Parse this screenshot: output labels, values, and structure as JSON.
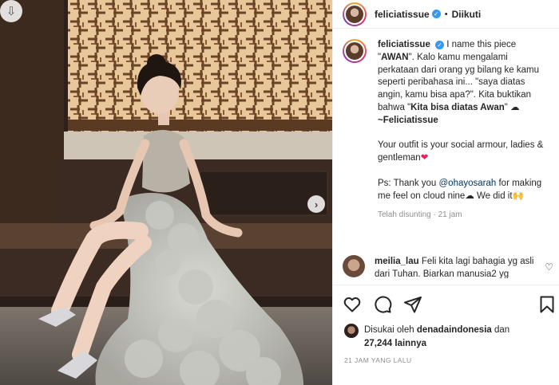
{
  "post": {
    "username": "feliciatissue",
    "follow_status": "Diikuti",
    "separator": "•"
  },
  "caption": {
    "username": "feliciatissue",
    "p1_a": "I name this piece \"",
    "p1_b": "AWAN",
    "p1_c": "\". Kalo kamu mengalami perkataan dari orang yg bilang ke kamu seperti peribahasa ini... \"saya diatas angin, kamu bisa apa?\". Kita buktikan bahwa \"",
    "p1_d": "Kita bisa diatas Awan",
    "p1_e": "\" ☁ ",
    "p1_f": "~Feliciatissue",
    "p2": "Your outfit is your social armour, ladies & gentleman",
    "p2_heart": "❤",
    "p3_a": "Ps: Thank you ",
    "p3_mention": "@ohayosarah",
    "p3_b": " for making me feel on cloud nine☁ We did it",
    "p3_emoji": "🙌",
    "meta": "Telah disunting · 21 jam"
  },
  "comment": {
    "username": "meilia_lau",
    "text": " Feli kita lagi bahagia yg asli dari Tuhan. Biarkan manusia2 yg"
  },
  "likes": {
    "prefix": "Disukai oleh ",
    "user": "denadaindonesia",
    "mid": " dan",
    "count": "27,244 lainnya"
  },
  "time_ago": "21 JAM YANG LALU",
  "icons": {
    "download": "download-icon",
    "next": "chevron-right-icon",
    "like": "heart-icon",
    "comment": "comment-icon",
    "share": "send-icon",
    "save": "bookmark-icon"
  },
  "colors": {
    "verified": "#3897f0",
    "mention": "#00376b",
    "heart": "#e0245e",
    "muted": "#8e8e8e"
  }
}
